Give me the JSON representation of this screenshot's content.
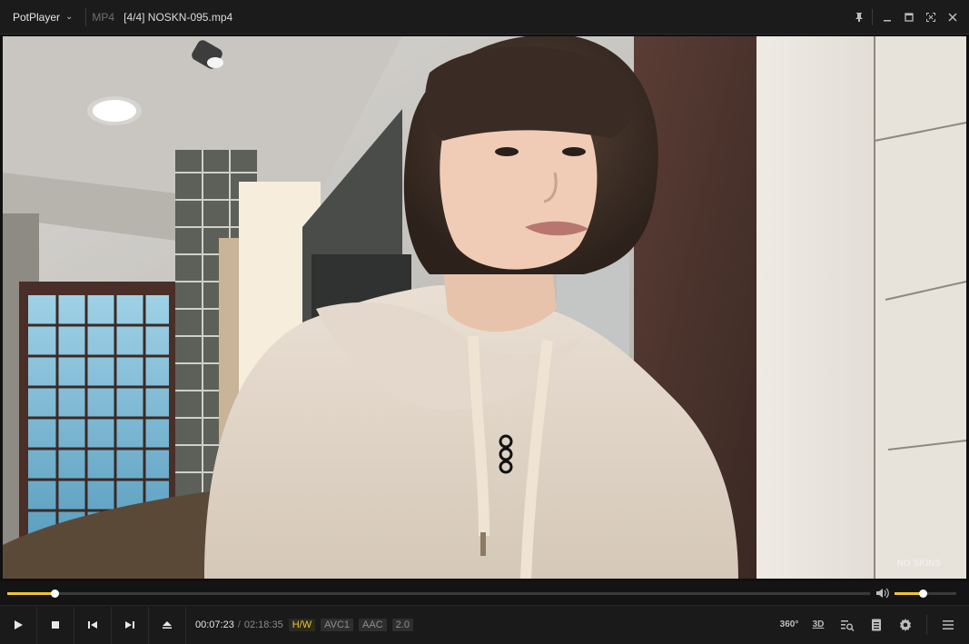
{
  "app": {
    "name": "PotPlayer",
    "format": "MP4",
    "title": "[4/4] NOSKN-095.mp4"
  },
  "window_controls": [
    "pin-icon",
    "minimize-icon",
    "maximize-icon",
    "fullscreen-icon",
    "close-icon"
  ],
  "video": {
    "watermark": "NO SKINS"
  },
  "playback": {
    "current_time": "00:07:23",
    "separator": "/",
    "duration": "02:18:35",
    "progress_fraction": 0.055,
    "volume_fraction": 0.45
  },
  "codec_tags": {
    "hw": "H/W",
    "video": "AVC1",
    "audio": "AAC",
    "channels": "2.0"
  },
  "tools": {
    "vr_label": "360°",
    "threed_label": "3D"
  },
  "colors": {
    "accent": "#f2c431",
    "background": "#1a1a1a"
  }
}
